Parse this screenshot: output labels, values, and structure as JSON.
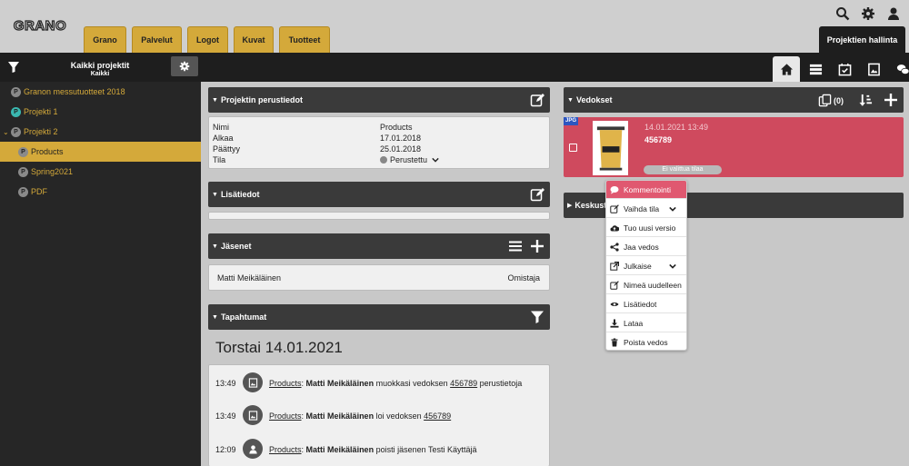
{
  "app": {
    "logo": "GRANO",
    "manage_tab": "Projektien hallinta"
  },
  "nav_tabs": [
    "Grano",
    "Palvelut",
    "Logot",
    "Kuvat",
    "Tuotteet"
  ],
  "project_header": {
    "title": "Kaikki projektit",
    "subtitle": "Kaikki"
  },
  "tree": [
    {
      "label": "Granon messutuotteet 2018",
      "badge": "P"
    },
    {
      "label": "Projekti 1",
      "badge": "P"
    },
    {
      "label": "Projekti 2",
      "badge": "P"
    },
    {
      "label": "Products",
      "badge": "P"
    },
    {
      "label": "Spring2021",
      "badge": "P"
    },
    {
      "label": "PDF",
      "badge": "P"
    }
  ],
  "basic_info": {
    "title": "Projektin perustiedot",
    "labels": {
      "name": "Nimi",
      "start": "Alkaa",
      "end": "Päättyy",
      "state": "Tila"
    },
    "values": {
      "name": "Products",
      "start": "17.01.2018",
      "end": "25.01.2018",
      "state": "Perustettu"
    }
  },
  "extra_info": {
    "title": "Lisätiedot"
  },
  "members": {
    "title": "Jäsenet",
    "rows": [
      {
        "name": "Matti Meikäläinen",
        "role": "Omistaja"
      }
    ]
  },
  "events": {
    "title": "Tapahtumat",
    "date": "Torstai 14.01.2021",
    "rows": [
      {
        "time": "13:49",
        "project": "Products",
        "user": "Matti Meikäläinen",
        "action": " muokkasi vedoksen ",
        "target": "456789",
        "suffix": " perustietoja"
      },
      {
        "time": "13:49",
        "project": "Products",
        "user": "Matti Meikäläinen",
        "action": " loi vedoksen ",
        "target": "456789",
        "suffix": ""
      },
      {
        "time": "12:09",
        "project": "Products",
        "user": "Matti Meikäläinen",
        "action": " poisti jäsenen Testi Käyttäjä",
        "target": "",
        "suffix": ""
      }
    ]
  },
  "proofs": {
    "title": "Vedokset",
    "count": "(0)",
    "card": {
      "type": "JPG",
      "date": "14.01.2021 13:49",
      "name": "456789",
      "status": "Ei valittua tilaa"
    }
  },
  "discussion": {
    "title": "Keskustelu"
  },
  "context_menu": [
    "Kommentointi",
    "Vaihda tila",
    "Tuo uusi versio",
    "Jaa vedos",
    "Julkaise",
    "Nimeä uudelleen",
    "Lisätiedot",
    "Lataa",
    "Poista vedos"
  ],
  "colors": {
    "accent": "#d4a93a",
    "proof_card": "#cf4a5e",
    "menu_highlight": "#e05870",
    "dark": "#1e1e1e"
  }
}
